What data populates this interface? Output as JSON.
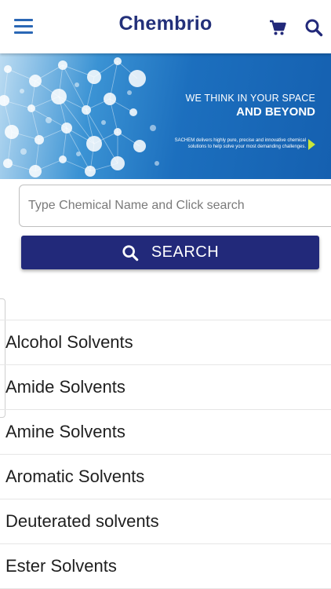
{
  "header": {
    "title": "Chembrio",
    "menu_icon": "hamburger-menu-icon",
    "cart_icon": "shopping-cart-icon",
    "search_icon": "search-icon",
    "title_color": "#23307a",
    "icon_color": "#2a67b5"
  },
  "banner": {
    "line1": "WE THINK IN YOUR SPACE",
    "line2": "AND BEYOND",
    "small_text_1": "SACHEM delivers highly pure, precise and innovative chemical",
    "small_text_2": "solutions to help solve your most demanding challenges."
  },
  "search": {
    "placeholder": "Type Chemical Name and Click search",
    "value": "",
    "button_label": "SEARCH",
    "button_color": "#22297a"
  },
  "categories": [
    "Alcohol Solvents",
    "Amide Solvents",
    "Amine Solvents",
    "Aromatic Solvents",
    "Deuterated solvents",
    "Ester Solvents"
  ]
}
